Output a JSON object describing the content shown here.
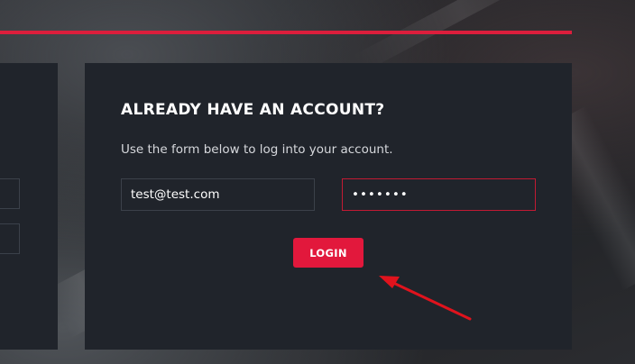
{
  "login": {
    "title": "ALREADY HAVE AN ACCOUNT?",
    "subtitle": "Use the form below to log into your account.",
    "email_value": "test@test.com",
    "password_value": "1234567",
    "button_label": "LOGIN"
  },
  "colors": {
    "accent": "#e2183c",
    "panel": "#20242b",
    "annotation_arrow": "#e0131d"
  },
  "icons": {
    "annotation": "red-pointer-arrow-icon"
  }
}
